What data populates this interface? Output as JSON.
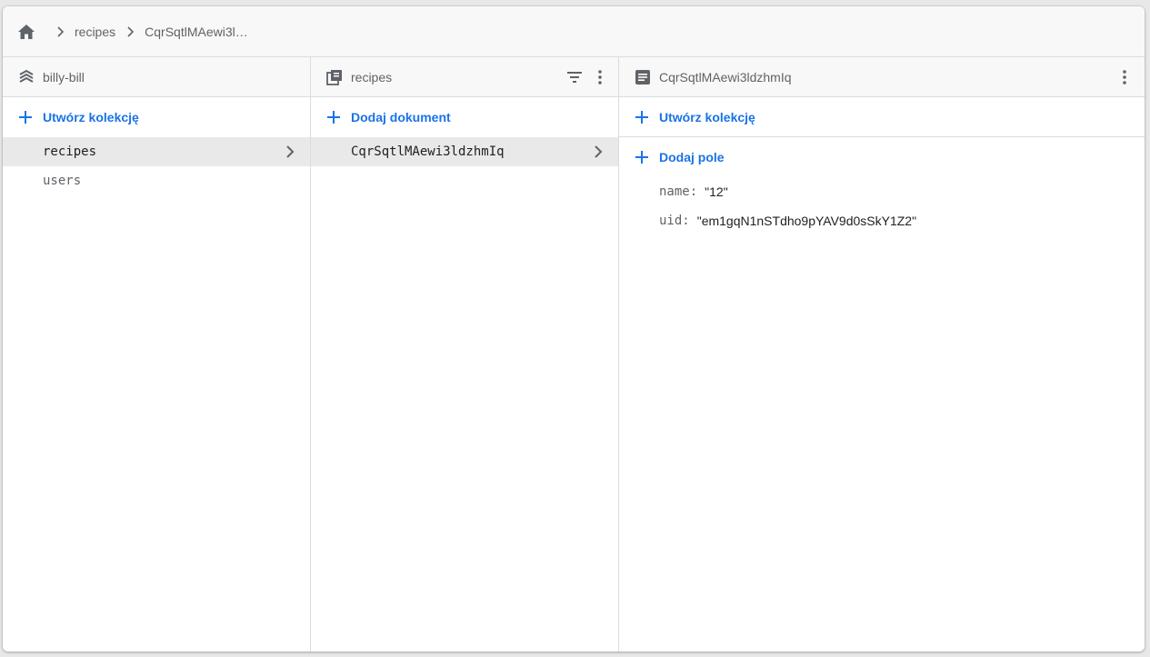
{
  "breadcrumb": {
    "items": [
      "recipes",
      "CqrSqtlMAewi3l…"
    ]
  },
  "root_column": {
    "title": "billy-bill",
    "create_collection_label": "Utwórz kolekcję",
    "collections": [
      "recipes",
      "users"
    ]
  },
  "collection_column": {
    "title": "recipes",
    "add_document_label": "Dodaj dokument",
    "documents": [
      "CqrSqtlMAewi3ldzhmIq"
    ]
  },
  "document_column": {
    "title": "CqrSqtlMAewi3ldzhmIq",
    "create_collection_label": "Utwórz kolekcję",
    "add_field_label": "Dodaj pole",
    "fields": [
      {
        "key": "name:",
        "value": "\"12\""
      },
      {
        "key": "uid:",
        "value": "\"em1gqN1nSTdho9pYAV9d0sSkY1Z2\""
      }
    ]
  },
  "colors": {
    "accent": "#1a73e8",
    "icon": "#5f6368",
    "selected_row": "#e9e9e9"
  }
}
